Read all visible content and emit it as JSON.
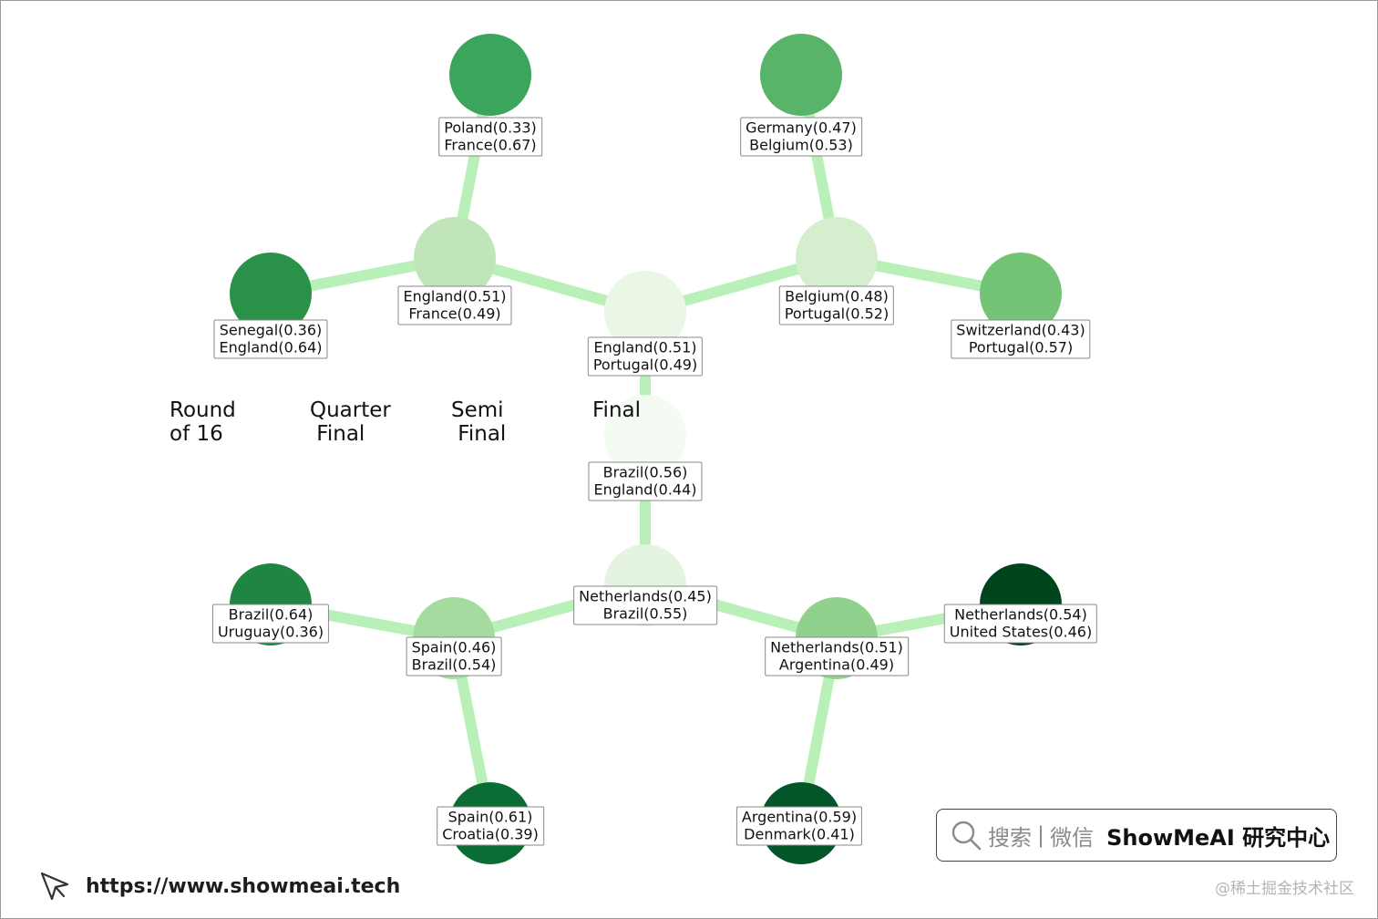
{
  "rounds": [
    {
      "id": "r16",
      "label": "Round\nof 16"
    },
    {
      "id": "qf",
      "label": "Quarter\n Final"
    },
    {
      "id": "sf",
      "label": "Semi\n Final"
    },
    {
      "id": "f",
      "label": "Final"
    }
  ],
  "matches": [
    {
      "id": "m_pol_fra",
      "team1": "Poland(0.33)",
      "team2": "France(0.67)",
      "color": "#3ca55c"
    },
    {
      "id": "m_ger_bel",
      "team1": "Germany(0.47)",
      "team2": "Belgium(0.53)",
      "color": "#58b468"
    },
    {
      "id": "m_sen_eng",
      "team1": "Senegal(0.36)",
      "team2": "England(0.64)",
      "color": "#2a9149"
    },
    {
      "id": "m_eng_fra",
      "team1": "England(0.51)",
      "team2": "France(0.49)",
      "color": "#bfe5b8"
    },
    {
      "id": "m_bel_por",
      "team1": "Belgium(0.48)",
      "team2": "Portugal(0.52)",
      "color": "#d4eece"
    },
    {
      "id": "m_swi_por",
      "team1": "Switzerland(0.43)",
      "team2": "Portugal(0.57)",
      "color": "#73c476"
    },
    {
      "id": "m_eng_por",
      "team1": "England(0.51)",
      "team2": "Portugal(0.49)",
      "color": "#eaf6e6"
    },
    {
      "id": "m_final",
      "team1": "Brazil(0.56)",
      "team2": "England(0.44)",
      "color": "#f4fbf2"
    },
    {
      "id": "m_ned_bra",
      "team1": "Netherlands(0.45)",
      "team2": "Brazil(0.55)",
      "color": "#e4f4e0"
    },
    {
      "id": "m_bra_uru",
      "team1": "Brazil(0.64)",
      "team2": "Uruguay(0.36)",
      "color": "#1e8543"
    },
    {
      "id": "m_ned_usa",
      "team1": "Netherlands(0.54)",
      "team2": "United States(0.46)",
      "color": "#00441b"
    },
    {
      "id": "m_spa_bra",
      "team1": "Spain(0.46)",
      "team2": "Brazil(0.54)",
      "color": "#a6dba0"
    },
    {
      "id": "m_ned_arg",
      "team1": "Netherlands(0.51)",
      "team2": "Argentina(0.49)",
      "color": "#90d18d"
    },
    {
      "id": "m_spa_cro",
      "team1": "Spain(0.61)",
      "team2": "Croatia(0.39)",
      "color": "#0b6d33"
    },
    {
      "id": "m_arg_den",
      "team1": "Argentina(0.59)",
      "team2": "Denmark(0.41)",
      "color": "#03552a"
    }
  ],
  "edge_color": "#b8f0b8",
  "footer": {
    "url": "https://www.showmeai.tech",
    "search_hint": "搜索",
    "separator": "|",
    "channel": "微信",
    "brand": "ShowMeAI 研究中心",
    "watermark": "@稀土掘金技术社区"
  }
}
